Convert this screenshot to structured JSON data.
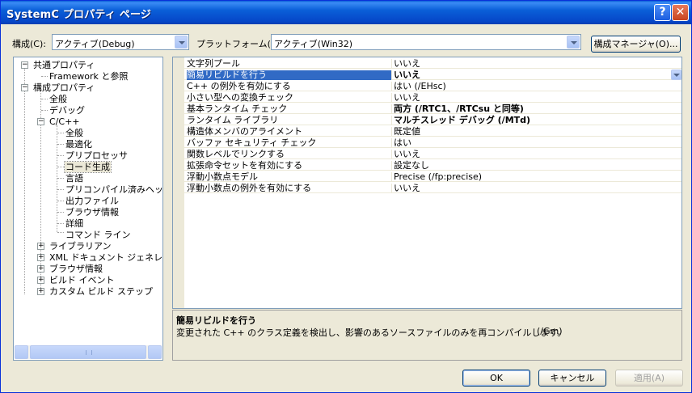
{
  "title": "SystemC プロパティ ページ",
  "titlebar": {
    "help": "?",
    "close": "✕"
  },
  "config": {
    "label": "構成(C):",
    "value": "アクティブ(Debug)"
  },
  "platform": {
    "label": "プラットフォーム(P):",
    "value": "アクティブ(Win32)"
  },
  "config_manager": "構成マネージャ(O)...",
  "tree": {
    "common": "共通プロパティ",
    "framework": "Framework と参照",
    "config_props": "構成プロパティ",
    "general": "全般",
    "debugging": "デバッグ",
    "cpp": "C/C++",
    "cpp_children": [
      "全般",
      "最適化",
      "プリプロセッサ",
      "コード生成",
      "言語",
      "プリコンパイル済みヘッダー",
      "出力ファイル",
      "ブラウザ情報",
      "詳細",
      "コマンド ライン"
    ],
    "after": [
      "ライブラリアン",
      "XML ドキュメント ジェネレータ",
      "ブラウザ情報",
      "ビルド イベント",
      "カスタム ビルド ステップ"
    ]
  },
  "properties": [
    {
      "name": "文字列プール",
      "value": "いいえ",
      "bold": false
    },
    {
      "name": "簡易リビルドを行う",
      "value": "いいえ",
      "bold": true
    },
    {
      "name": "C++ の例外を有効にする",
      "value": "はい (/EHsc)",
      "bold": false
    },
    {
      "name": "小さい型への変換チェック",
      "value": "いいえ",
      "bold": false
    },
    {
      "name": "基本ランタイム チェック",
      "value": "両方 (/RTC1、/RTCsu と同等)",
      "bold": true
    },
    {
      "name": "ランタイム ライブラリ",
      "value": "マルチスレッド デバッグ (/MTd)",
      "bold": true
    },
    {
      "name": "構造体メンバのアライメント",
      "value": "既定値",
      "bold": false
    },
    {
      "name": "バッファ セキュリティ チェック",
      "value": "はい",
      "bold": false
    },
    {
      "name": "関数レベルでリンクする",
      "value": "いいえ",
      "bold": false
    },
    {
      "name": "拡張命令セットを有効にする",
      "value": "設定なし",
      "bold": false
    },
    {
      "name": "浮動小数点モデル",
      "value": "Precise (/fp:precise)",
      "bold": false
    },
    {
      "name": "浮動小数点の例外を有効にする",
      "value": "いいえ",
      "bold": false
    }
  ],
  "description": {
    "title": "簡易リビルドを行う",
    "text": "変更された C++ のクラス定義を検出し、影響のあるソースファイルのみを再コンパイルします。",
    "code": "(/Gm)"
  },
  "buttons": {
    "ok": "OK",
    "cancel": "キャンセル",
    "apply": "適用(A)"
  }
}
